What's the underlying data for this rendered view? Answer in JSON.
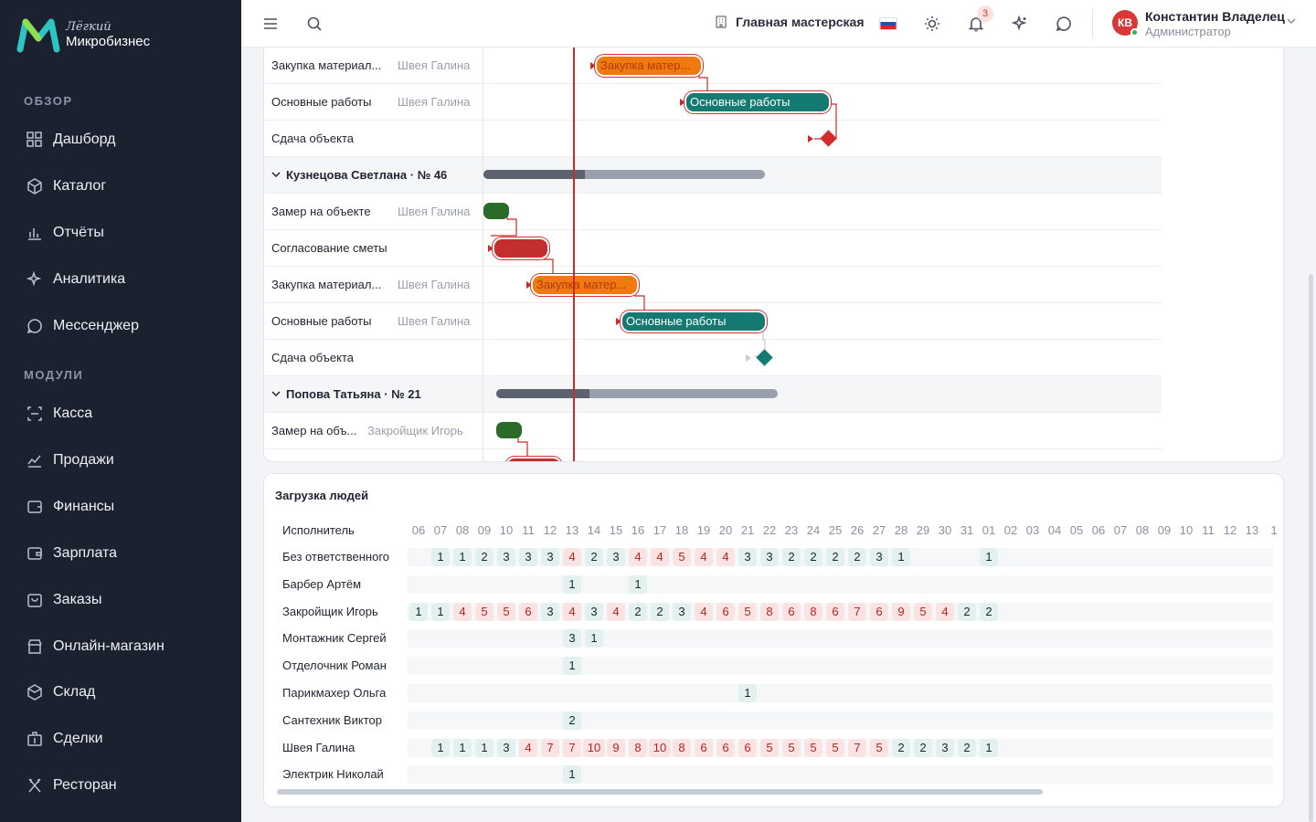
{
  "brand": {
    "line1": "Лёгкий",
    "line2": "Микробизнес"
  },
  "sidebar": {
    "section1": "ОБЗОР",
    "items1": [
      {
        "label": "Дашборд",
        "icon": "dashboard-icon"
      },
      {
        "label": "Каталог",
        "icon": "catalog-icon"
      },
      {
        "label": "Отчёты",
        "icon": "reports-icon"
      },
      {
        "label": "Аналитика",
        "icon": "analytics-icon"
      },
      {
        "label": "Мессенджер",
        "icon": "messenger-icon"
      }
    ],
    "section2": "МОДУЛИ",
    "items2": [
      {
        "label": "Касса",
        "icon": "cashbox-icon"
      },
      {
        "label": "Продажи",
        "icon": "sales-icon"
      },
      {
        "label": "Финансы",
        "icon": "finance-icon"
      },
      {
        "label": "Зарплата",
        "icon": "salary-icon"
      },
      {
        "label": "Заказы",
        "icon": "orders-icon"
      },
      {
        "label": "Онлайн-магазин",
        "icon": "shop-icon"
      },
      {
        "label": "Склад",
        "icon": "warehouse-icon"
      },
      {
        "label": "Сделки",
        "icon": "deals-icon"
      },
      {
        "label": "Ресторан",
        "icon": "restaurant-icon"
      }
    ]
  },
  "topbar": {
    "workspace": "Главная мастерская",
    "notifications_count": "3",
    "user_initials": "КВ",
    "user_name": "Константин Владелец",
    "user_role": "Администратор"
  },
  "gantt": {
    "rows": [
      {
        "name": "Закупка материал...",
        "assignee": "Швея Галина"
      },
      {
        "name": "Основные работы",
        "assignee": "Швея Галина"
      },
      {
        "name": "Сдача объекта",
        "assignee": ""
      },
      {
        "name": "Кузнецова Светлана · № 46",
        "group": true
      },
      {
        "name": "Замер на объекте",
        "assignee": "Швея Галина"
      },
      {
        "name": "Согласование сметы",
        "assignee": ""
      },
      {
        "name": "Закупка материал...",
        "assignee": "Швея Галина"
      },
      {
        "name": "Основные работы",
        "assignee": "Швея Галина"
      },
      {
        "name": "Сдача объекта",
        "assignee": ""
      },
      {
        "name": "Попова Татьяна · № 21",
        "group": true
      },
      {
        "name": "Замер на объ...",
        "assignee": "Закройщик Игорь"
      }
    ],
    "bars": {
      "b1": "Закупка матер...",
      "b2": "Основные работы",
      "b3": "Закупка матер...",
      "b4": "Основные работы"
    },
    "progress": {
      "group1": 0.36,
      "group2": 0.33
    }
  },
  "load": {
    "title": "Загрузка людей",
    "header": "Исполнитель",
    "days": [
      "06",
      "07",
      "08",
      "09",
      "10",
      "11",
      "12",
      "13",
      "14",
      "15",
      "16",
      "17",
      "18",
      "19",
      "20",
      "21",
      "22",
      "23",
      "24",
      "25",
      "26",
      "27",
      "28",
      "29",
      "30",
      "31",
      "01",
      "02",
      "03",
      "04",
      "05",
      "06",
      "07",
      "08",
      "09",
      "10",
      "11",
      "12",
      "13",
      "1"
    ],
    "rows": [
      {
        "name": "Без ответственного",
        "cells": [
          null,
          1,
          1,
          2,
          3,
          3,
          3,
          4,
          2,
          3,
          4,
          4,
          5,
          4,
          4,
          3,
          3,
          2,
          2,
          2,
          2,
          3,
          1,
          null,
          null,
          null,
          1
        ]
      },
      {
        "name": "Барбер Артём",
        "cells": [
          null,
          null,
          null,
          null,
          null,
          null,
          null,
          1,
          null,
          null,
          1
        ]
      },
      {
        "name": "Закройщик Игорь",
        "cells": [
          1,
          1,
          4,
          5,
          5,
          6,
          3,
          4,
          3,
          4,
          2,
          2,
          3,
          4,
          6,
          5,
          8,
          6,
          8,
          6,
          7,
          6,
          9,
          5,
          4,
          2,
          2
        ]
      },
      {
        "name": "Монтажник Сергей",
        "cells": [
          null,
          null,
          null,
          null,
          null,
          null,
          null,
          3,
          1
        ]
      },
      {
        "name": "Отделочник Роман",
        "cells": [
          null,
          null,
          null,
          null,
          null,
          null,
          null,
          1
        ]
      },
      {
        "name": "Парикмахер Ольга",
        "cells": [
          null,
          null,
          null,
          null,
          null,
          null,
          null,
          null,
          null,
          null,
          null,
          null,
          null,
          null,
          null,
          1
        ]
      },
      {
        "name": "Сантехник Виктор",
        "cells": [
          null,
          null,
          null,
          null,
          null,
          null,
          null,
          2
        ]
      },
      {
        "name": "Швея Галина",
        "cells": [
          null,
          1,
          1,
          1,
          3,
          4,
          7,
          7,
          10,
          9,
          8,
          10,
          8,
          6,
          6,
          6,
          5,
          5,
          5,
          5,
          7,
          5,
          2,
          2,
          3,
          2,
          1
        ]
      },
      {
        "name": "Электрик Николай",
        "cells": [
          null,
          null,
          null,
          null,
          null,
          null,
          null,
          1
        ]
      }
    ]
  }
}
